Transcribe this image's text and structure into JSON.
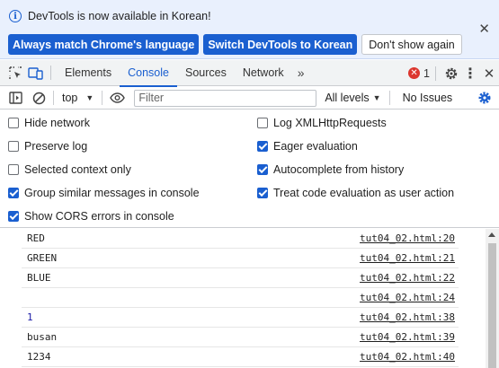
{
  "infobar": {
    "message": "DevTools is now available in Korean!",
    "buttons": {
      "match": "Always match Chrome's language",
      "switch": "Switch DevTools to Korean",
      "dismiss": "Don't show again"
    },
    "close_glyph": "✕"
  },
  "tabs": {
    "items": [
      "Elements",
      "Console",
      "Sources",
      "Network"
    ],
    "active": "Console",
    "more_glyph": "»",
    "error_count": "1",
    "error_glyph": "✕",
    "kebab_glyph": "⋮",
    "close_glyph": "✕"
  },
  "console_toolbar": {
    "context": "top",
    "filter_placeholder": "Filter",
    "filter_value": "",
    "levels": "All levels",
    "issues": "No Issues"
  },
  "settings": {
    "left": [
      {
        "label": "Hide network",
        "checked": false
      },
      {
        "label": "Preserve log",
        "checked": false
      },
      {
        "label": "Selected context only",
        "checked": false
      },
      {
        "label": "Group similar messages in console",
        "checked": true
      },
      {
        "label": "Show CORS errors in console",
        "checked": true
      }
    ],
    "right": [
      {
        "label": "Log XMLHttpRequests",
        "checked": false
      },
      {
        "label": "Eager evaluation",
        "checked": true
      },
      {
        "label": "Autocomplete from history",
        "checked": true
      },
      {
        "label": "Treat code evaluation as user action",
        "checked": true
      }
    ]
  },
  "log": [
    {
      "message": "RED",
      "source": "tut04_02.html:20",
      "type": "text"
    },
    {
      "message": "GREEN",
      "source": "tut04_02.html:21",
      "type": "text"
    },
    {
      "message": "BLUE",
      "source": "tut04_02.html:22",
      "type": "text"
    },
    {
      "message": "",
      "source": "tut04_02.html:24",
      "type": "text"
    },
    {
      "message": "1",
      "source": "tut04_02.html:38",
      "type": "number"
    },
    {
      "message": "busan",
      "source": "tut04_02.html:39",
      "type": "text"
    },
    {
      "message": "1234",
      "source": "tut04_02.html:40",
      "type": "text"
    }
  ],
  "colors": {
    "accent": "#1a5fd0",
    "error": "#dc362e",
    "infobar_bg": "#e9f0fd",
    "toolbar_bg": "#f1f3f4"
  },
  "icons": [
    "info-icon",
    "inspect-element-icon",
    "device-toggle-icon",
    "more-tabs-icon",
    "error-icon",
    "gear-icon",
    "kebab-menu-icon",
    "close-icon",
    "sidebar-toggle-icon",
    "clear-console-icon",
    "eye-icon",
    "settings-gear-icon"
  ]
}
